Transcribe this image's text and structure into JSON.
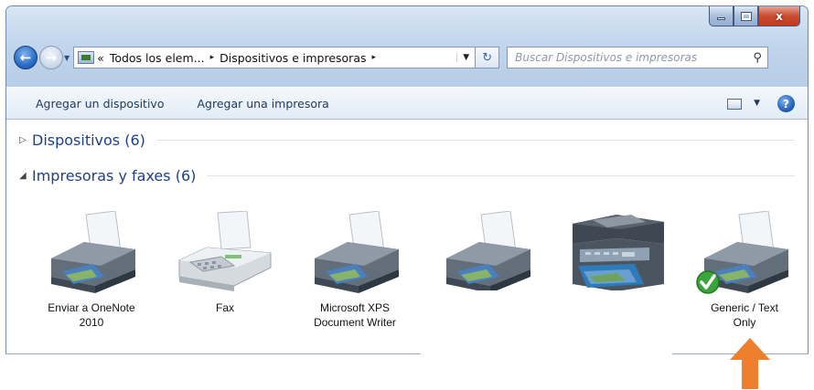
{
  "window": {
    "caption_buttons": {
      "minimize_icon": "minimize-icon",
      "maximize_icon": "maximize-icon",
      "close_label": "x"
    }
  },
  "address_bar": {
    "prefix": "«",
    "crumbs": [
      "Todos los elem...",
      "Dispositivos e impresoras"
    ],
    "separator": "▸"
  },
  "search": {
    "placeholder": "Buscar Dispositivos e impresoras"
  },
  "command_bar": {
    "items": [
      "Agregar un dispositivo",
      "Agregar una impresora"
    ]
  },
  "groups": {
    "devices": {
      "label": "Dispositivos (6)",
      "collapsed": true
    },
    "printers": {
      "label": "Impresoras y faxes (6)",
      "collapsed": false
    }
  },
  "printers": [
    {
      "label_line1": "Enviar a OneNote",
      "label_line2": "2010",
      "icon": "printer-icon"
    },
    {
      "label_line1": "Fax",
      "label_line2": "",
      "icon": "fax-icon"
    },
    {
      "label_line1": "Microsoft XPS",
      "label_line2": "Document Writer",
      "icon": "printer-icon"
    },
    {
      "label_line1": "",
      "label_line2": "",
      "icon": "printer-icon"
    },
    {
      "label_line1": "",
      "label_line2": "",
      "icon": "multifunction-printer-icon"
    },
    {
      "label_line1": "Generic / Text",
      "label_line2": "Only",
      "icon": "default-printer-icon",
      "is_default": true
    }
  ],
  "colors": {
    "accent_arrow": "#ee7f2c",
    "default_check": "#3aa53a"
  }
}
